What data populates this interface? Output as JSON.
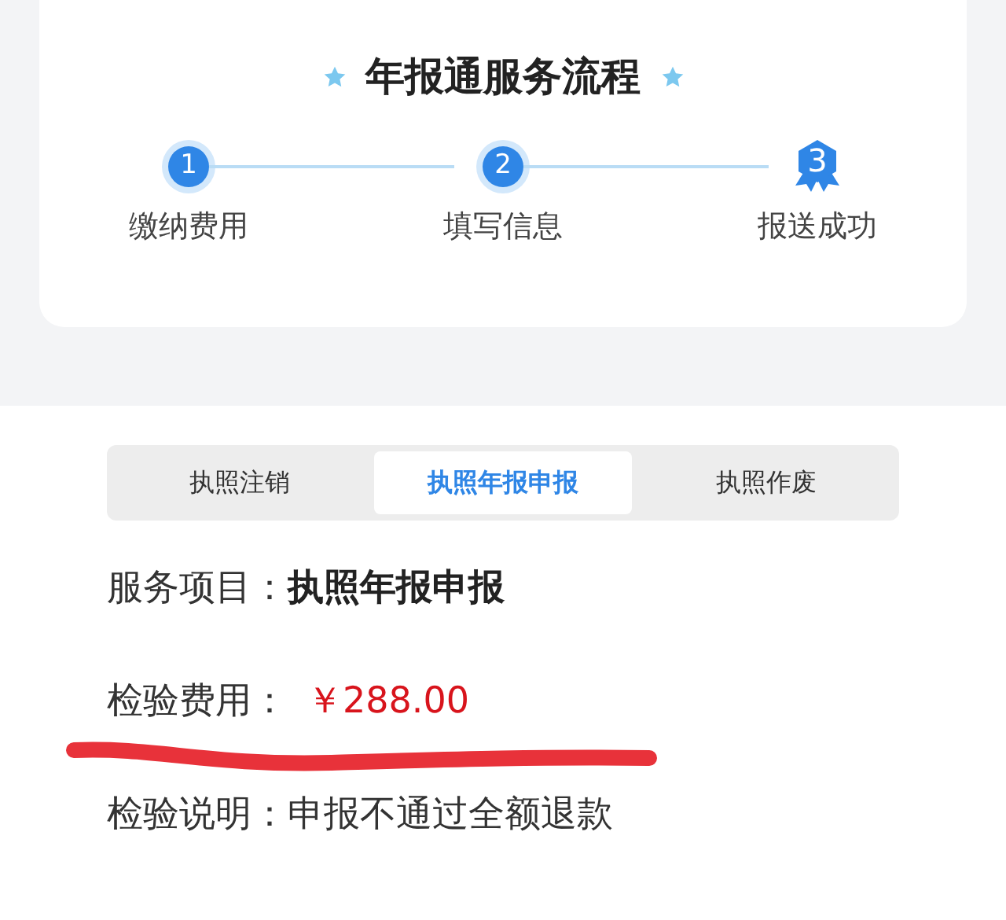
{
  "process": {
    "title": "年报通服务流程",
    "steps": [
      {
        "kind": "number",
        "number": "1",
        "label": "缴纳费用"
      },
      {
        "kind": "number",
        "number": "2",
        "label": "填写信息"
      },
      {
        "kind": "badge",
        "number": "3",
        "label": "报送成功"
      }
    ]
  },
  "tabs": [
    {
      "label": "执照注销",
      "selected": false
    },
    {
      "label": "执照年报申报",
      "selected": true
    },
    {
      "label": "执照作废",
      "selected": false
    }
  ],
  "details": [
    {
      "kind": "bold",
      "label": "服务项目：",
      "value": "执照年报申报"
    },
    {
      "kind": "price",
      "label": "检验费用：",
      "value": "￥288.00"
    },
    {
      "kind": "plain",
      "label": "检验说明：",
      "value": "申报不通过全额退款"
    }
  ]
}
